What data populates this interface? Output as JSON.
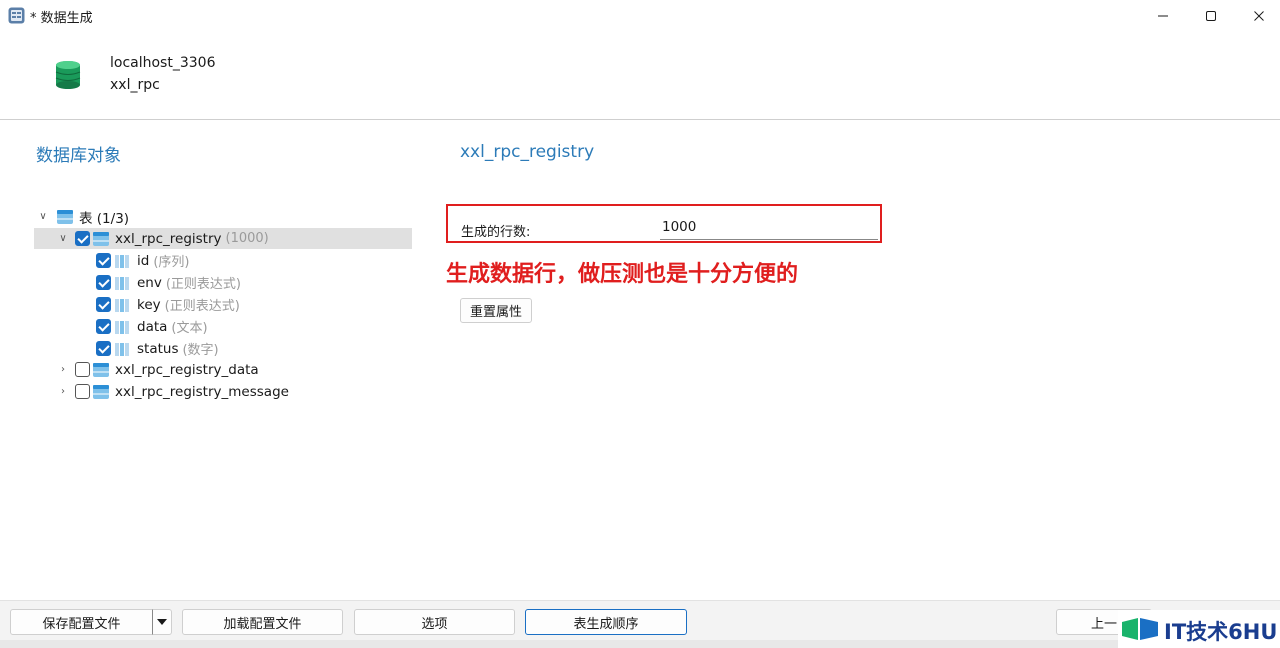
{
  "window": {
    "title": "* 数据生成",
    "controls": [
      "minimize",
      "maximize",
      "close"
    ]
  },
  "connection": {
    "name": "localhost_3306",
    "database": "xxl_rpc"
  },
  "left_panel": {
    "title": "数据库对象",
    "tree": {
      "root_label": "表 (1/3)",
      "tables": [
        {
          "name": "xxl_rpc_registry",
          "hint": "(1000)",
          "checked": true,
          "expanded": true,
          "columns": [
            {
              "name": "id",
              "hint": "(序列)",
              "checked": true
            },
            {
              "name": "env",
              "hint": "(正则表达式)",
              "checked": true
            },
            {
              "name": "key",
              "hint": "(正则表达式)",
              "checked": true
            },
            {
              "name": "data",
              "hint": "(文本)",
              "checked": true
            },
            {
              "name": "status",
              "hint": "(数字)",
              "checked": true
            }
          ]
        },
        {
          "name": "xxl_rpc_registry_data",
          "checked": false,
          "expanded": false
        },
        {
          "name": "xxl_rpc_registry_message",
          "checked": false,
          "expanded": false
        }
      ]
    }
  },
  "right_panel": {
    "title": "xxl_rpc_registry",
    "rows_label": "生成的行数:",
    "rows_value": "1000",
    "annotation": "生成数据行，做压测也是十分方便的",
    "reset_button": "重置属性"
  },
  "footer": {
    "save_config": "保存配置文件",
    "load_config": "加载配置文件",
    "options": "选项",
    "table_order": "表生成顺序",
    "prev": "上一"
  },
  "watermark": {
    "text": "IT技术6HU"
  },
  "colors": {
    "accent_blue": "#2c7bb8",
    "checkbox_blue": "#1a6fc4",
    "highlight_red": "#e01e1e",
    "db_green": "#1a9a5a"
  }
}
